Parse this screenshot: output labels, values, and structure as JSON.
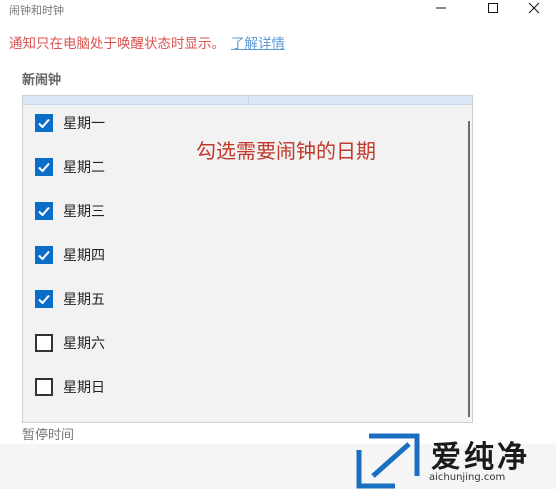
{
  "window": {
    "title": "闹钟和时钟",
    "minimize_icon": "minimize-icon",
    "maximize_icon": "maximize-icon",
    "close_icon": "close-icon"
  },
  "notice": {
    "text": "通知只在电脑处于唤醒状态时显示。",
    "link": "了解详情"
  },
  "new_alarm_label": "新闹钟",
  "repeat_days": [
    {
      "label": "星期一",
      "checked": true
    },
    {
      "label": "星期二",
      "checked": true
    },
    {
      "label": "星期三",
      "checked": true
    },
    {
      "label": "星期四",
      "checked": true
    },
    {
      "label": "星期五",
      "checked": true
    },
    {
      "label": "星期六",
      "checked": false
    },
    {
      "label": "星期日",
      "checked": false
    }
  ],
  "annotation": "勾选需要闹钟的日期",
  "pause_label": "暂停时间",
  "watermark": {
    "text": "爱纯净",
    "url": "aichunjing.com"
  },
  "colors": {
    "notice": "#d9534f",
    "link": "#5b9bd5",
    "checkbox_checked": "#0a6ec9",
    "annotation": "#c0392b"
  }
}
